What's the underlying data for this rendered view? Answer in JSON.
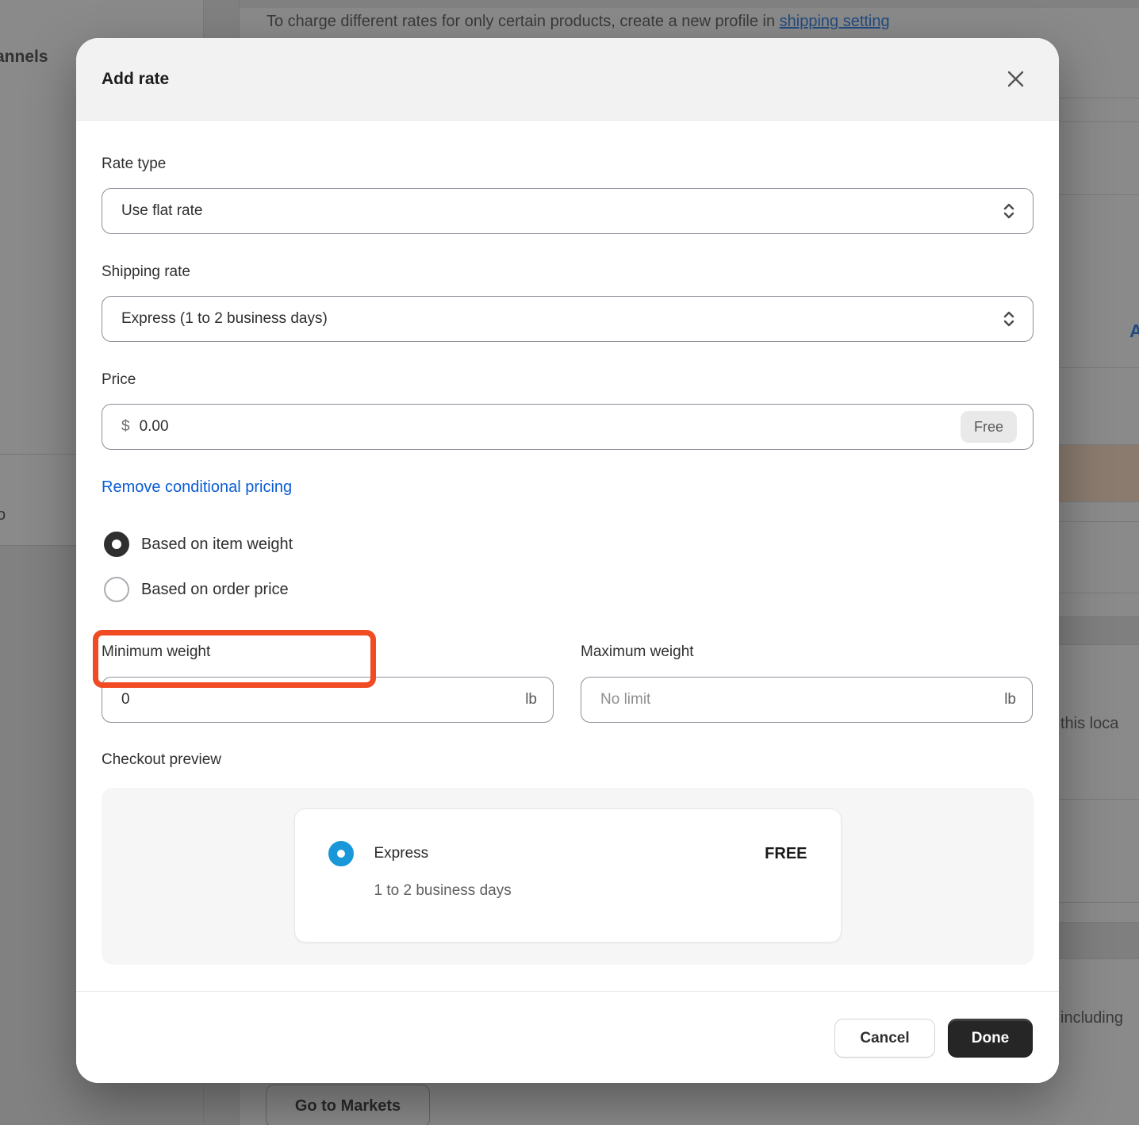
{
  "background": {
    "sidebar_fragment": "annels",
    "sidebar_row_fragment": "o",
    "banner_text": "To charge different rates for only certain products, create a new profile in ",
    "banner_link": "shipping setting",
    "add_rate_link_fragment": "A",
    "location_fragment": "this loca",
    "including_fragment": "including",
    "go_to_markets_label": "Go to Markets"
  },
  "modal": {
    "title": "Add rate",
    "rate_type": {
      "label": "Rate type",
      "value": "Use flat rate"
    },
    "shipping_rate": {
      "label": "Shipping rate",
      "value": "Express (1 to 2 business days)"
    },
    "price": {
      "label": "Price",
      "prefix": "$",
      "value": "0.00",
      "badge": "Free"
    },
    "remove_link_label": "Remove conditional pricing",
    "radios": [
      {
        "label": "Based on item weight",
        "selected": true,
        "highlighted": true
      },
      {
        "label": "Based on order price",
        "selected": false,
        "highlighted": false
      }
    ],
    "min_weight": {
      "label": "Minimum weight",
      "value": "0",
      "unit": "lb"
    },
    "max_weight": {
      "label": "Maximum weight",
      "placeholder": "No limit",
      "unit": "lb"
    },
    "checkout_preview": {
      "label": "Checkout preview",
      "option_name": "Express",
      "option_price": "FREE",
      "option_description": "1 to 2 business days"
    },
    "footer": {
      "cancel_label": "Cancel",
      "done_label": "Done"
    }
  },
  "colors": {
    "annotation_orange": "#F04B23",
    "link_blue": "#0B5CD5",
    "checkout_radio_blue": "#1898D8",
    "selected_radio_dark": "#2F2F2F",
    "primary_button": "#262626",
    "modal_header_gray": "#F2F2F2",
    "backdrop_tan_band": "#FFE1C6"
  }
}
